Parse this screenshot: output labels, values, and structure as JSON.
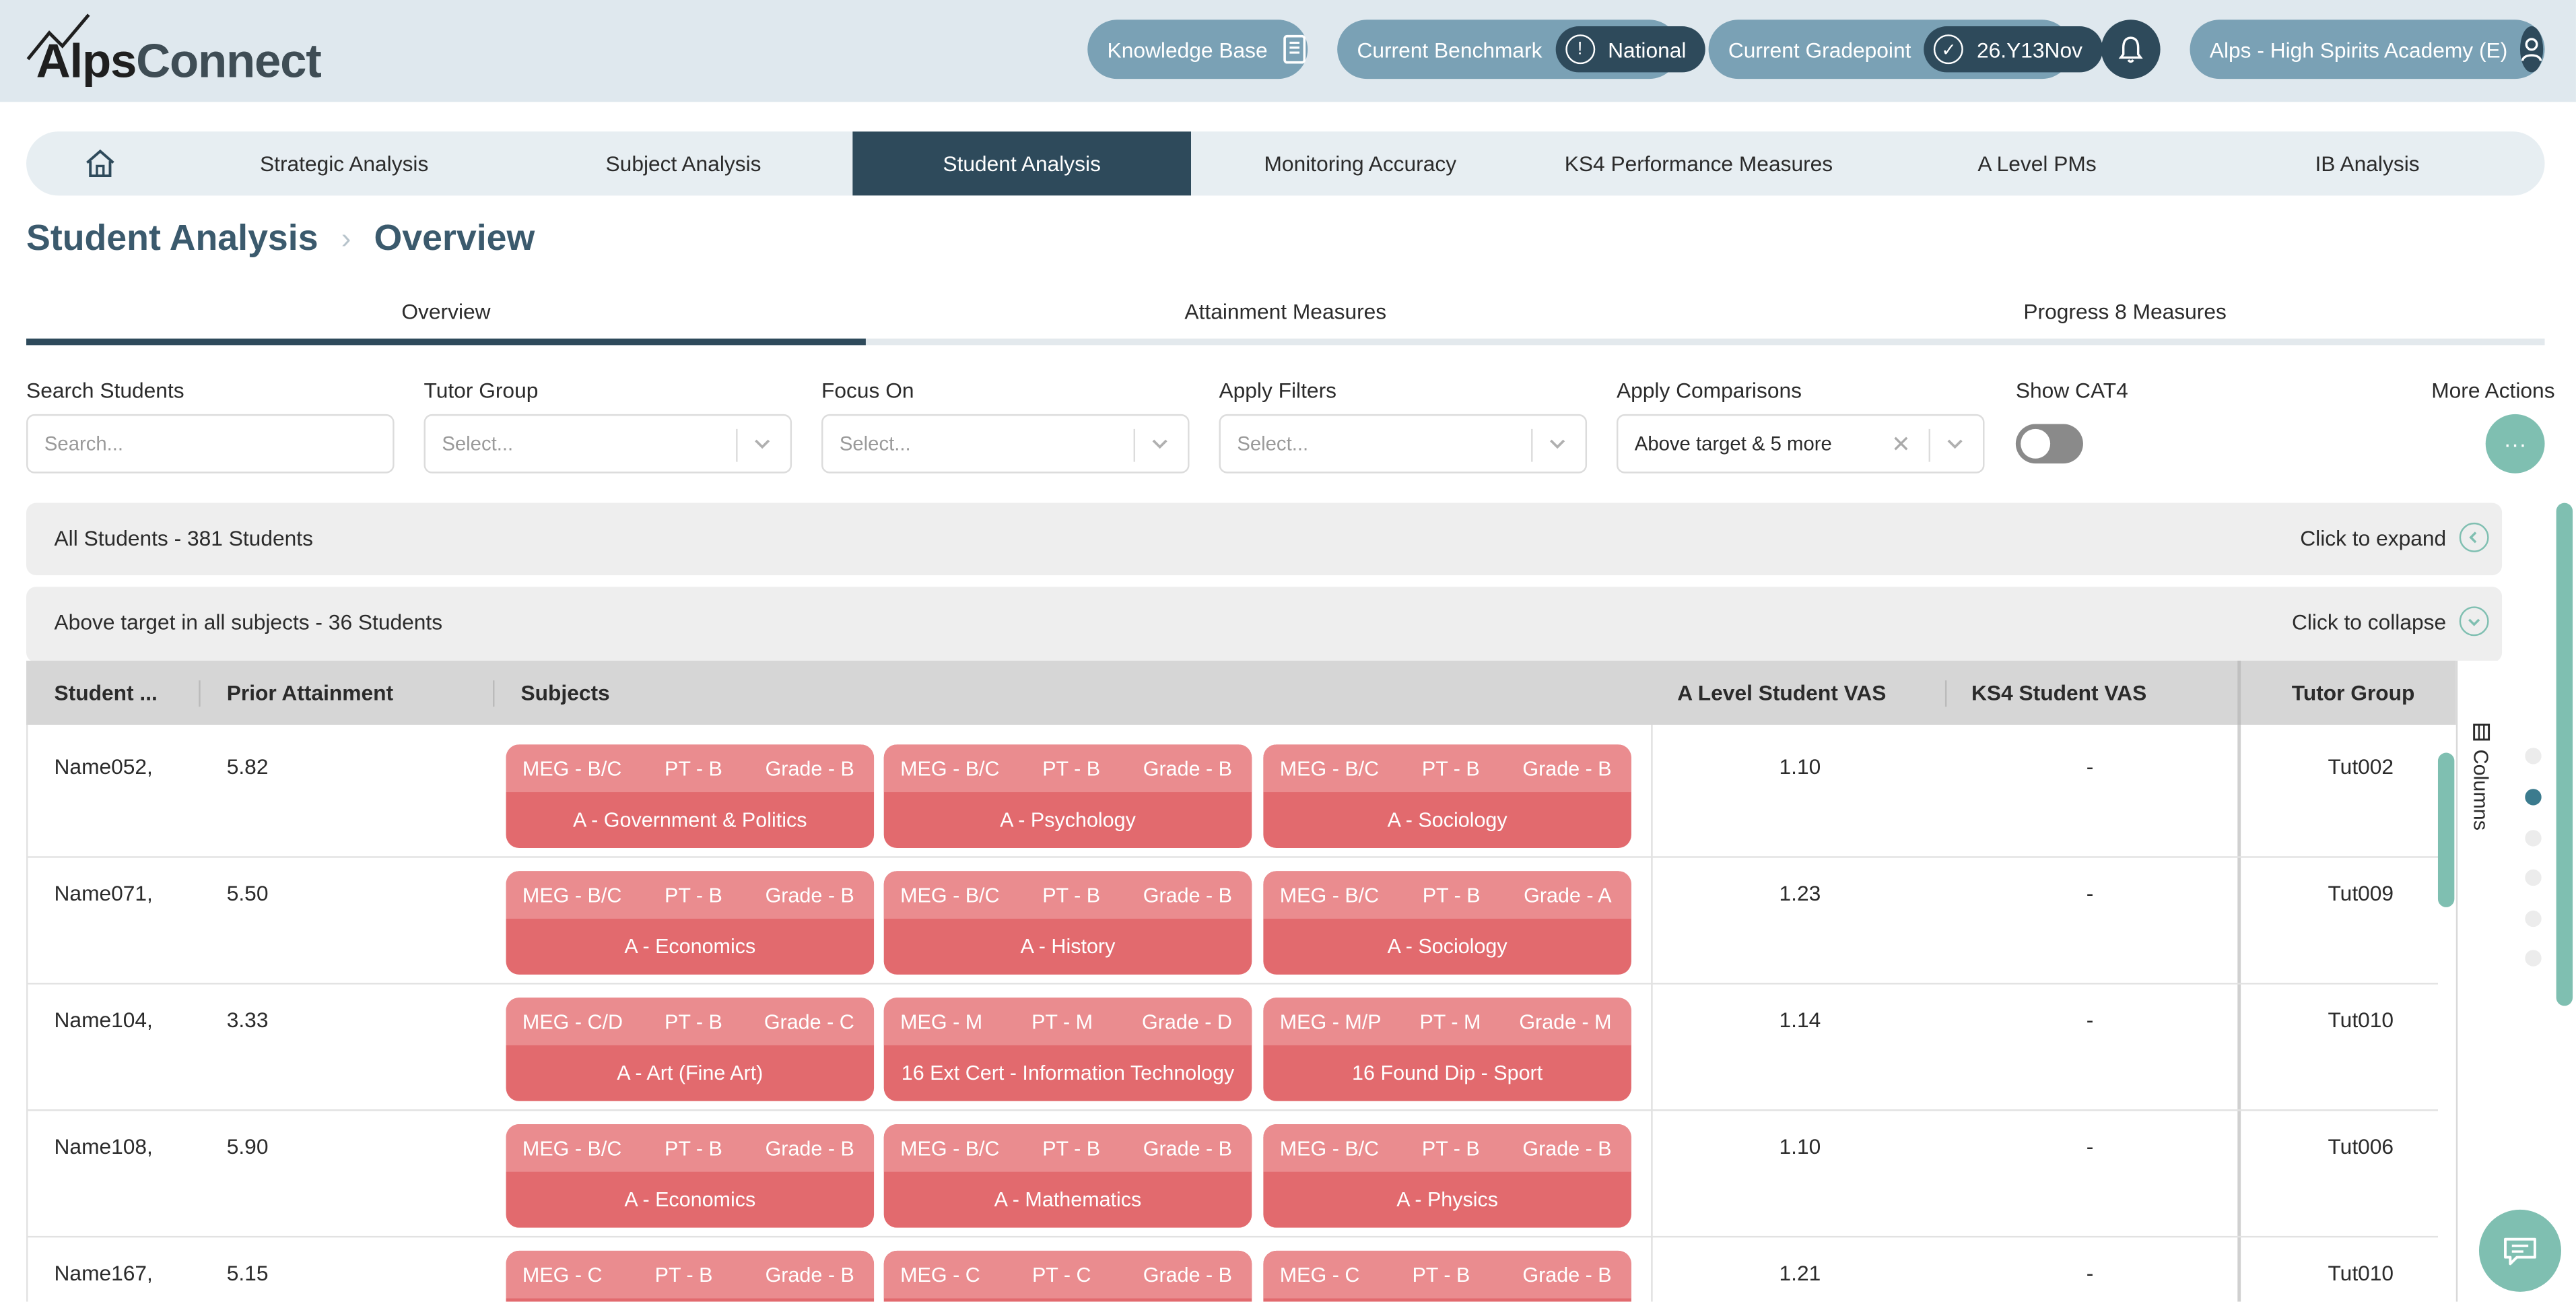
{
  "app": {
    "logo_alps": "Alps",
    "logo_connect": "Connect"
  },
  "header": {
    "knowledge_base": "Knowledge Base",
    "benchmark_label": "Current Benchmark",
    "benchmark_value": "National",
    "gradepoint_label": "Current Gradepoint",
    "gradepoint_value": "26.Y13Nov",
    "school": "Alps - High Spirits Academy (E)"
  },
  "nav": {
    "items": [
      {
        "label": "Strategic Analysis"
      },
      {
        "label": "Subject Analysis"
      },
      {
        "label": "Student Analysis"
      },
      {
        "label": "Monitoring Accuracy"
      },
      {
        "label": "KS4 Performance Measures"
      },
      {
        "label": "A Level PMs"
      },
      {
        "label": "IB Analysis"
      }
    ],
    "active_index": 2
  },
  "breadcrumb": {
    "section": "Student Analysis",
    "page": "Overview"
  },
  "tabs": [
    "Overview",
    "Attainment Measures",
    "Progress 8 Measures"
  ],
  "filters": {
    "search_label": "Search Students",
    "search_placeholder": "Search...",
    "tutor_label": "Tutor Group",
    "tutor_placeholder": "Select...",
    "focus_label": "Focus On",
    "focus_placeholder": "Select...",
    "filters_label": "Apply Filters",
    "filters_placeholder": "Select...",
    "comparisons_label": "Apply Comparisons",
    "comparisons_value": "Above target & 5 more",
    "cat4_label": "Show CAT4",
    "more_label": "More Actions",
    "more_glyph": "···"
  },
  "groups": {
    "all": {
      "title": "All Students - 381 Students",
      "action": "Click to expand"
    },
    "above": {
      "title": "Above target in all subjects - 36 Students",
      "action": "Click to collapse"
    }
  },
  "table": {
    "headers": {
      "student": "Student ...",
      "prior": "Prior Attainment",
      "subjects": "Subjects",
      "alevel_vas": "A Level Student VAS",
      "ks4_vas": "KS4 Student VAS",
      "tutor": "Tutor Group"
    },
    "columns_label": "Columns",
    "rows": [
      {
        "name": "Name052,",
        "prior": "5.82",
        "alevel": "1.10",
        "ks4": "-",
        "tutor": "Tut002",
        "subjects": [
          {
            "meg": "MEG - B/C",
            "pt": "PT - B",
            "grade": "Grade - B",
            "name": "A - Government & Politics"
          },
          {
            "meg": "MEG - B/C",
            "pt": "PT - B",
            "grade": "Grade - B",
            "name": "A - Psychology"
          },
          {
            "meg": "MEG - B/C",
            "pt": "PT - B",
            "grade": "Grade - B",
            "name": "A - Sociology"
          }
        ]
      },
      {
        "name": "Name071,",
        "prior": "5.50",
        "alevel": "1.23",
        "ks4": "-",
        "tutor": "Tut009",
        "subjects": [
          {
            "meg": "MEG - B/C",
            "pt": "PT - B",
            "grade": "Grade - B",
            "name": "A - Economics"
          },
          {
            "meg": "MEG - B/C",
            "pt": "PT - B",
            "grade": "Grade - B",
            "name": "A - History"
          },
          {
            "meg": "MEG - B/C",
            "pt": "PT - B",
            "grade": "Grade - A",
            "name": "A - Sociology"
          }
        ]
      },
      {
        "name": "Name104,",
        "prior": "3.33",
        "alevel": "1.14",
        "ks4": "-",
        "tutor": "Tut010",
        "subjects": [
          {
            "meg": "MEG - C/D",
            "pt": "PT - B",
            "grade": "Grade - C",
            "name": "A - Art (Fine Art)"
          },
          {
            "meg": "MEG - M",
            "pt": "PT - M",
            "grade": "Grade - D",
            "name": "16 Ext Cert - Information Technology"
          },
          {
            "meg": "MEG - M/P",
            "pt": "PT - M",
            "grade": "Grade - M",
            "name": "16 Found Dip - Sport"
          }
        ]
      },
      {
        "name": "Name108,",
        "prior": "5.90",
        "alevel": "1.10",
        "ks4": "-",
        "tutor": "Tut006",
        "subjects": [
          {
            "meg": "MEG - B/C",
            "pt": "PT - B",
            "grade": "Grade - B",
            "name": "A - Economics"
          },
          {
            "meg": "MEG - B/C",
            "pt": "PT - B",
            "grade": "Grade - B",
            "name": "A - Mathematics"
          },
          {
            "meg": "MEG - B/C",
            "pt": "PT - B",
            "grade": "Grade - B",
            "name": "A - Physics"
          }
        ]
      },
      {
        "name": "Name167,",
        "prior": "5.15",
        "alevel": "1.21",
        "ks4": "-",
        "tutor": "Tut010",
        "subjects": [
          {
            "meg": "MEG - C",
            "pt": "PT - B",
            "grade": "Grade - B",
            "name": ""
          },
          {
            "meg": "MEG - C",
            "pt": "PT - C",
            "grade": "Grade - B",
            "name": ""
          },
          {
            "meg": "MEG - C",
            "pt": "PT - B",
            "grade": "Grade - B",
            "name": ""
          }
        ]
      }
    ]
  },
  "colors": {
    "header_bg": "#dfe8ee",
    "nav_active": "#2e4a5b",
    "pill": "#7aa1b5",
    "accent_teal": "#7fbfb1",
    "subject_red": "#e26a6e",
    "subject_red_light": "#ea8c8f"
  }
}
